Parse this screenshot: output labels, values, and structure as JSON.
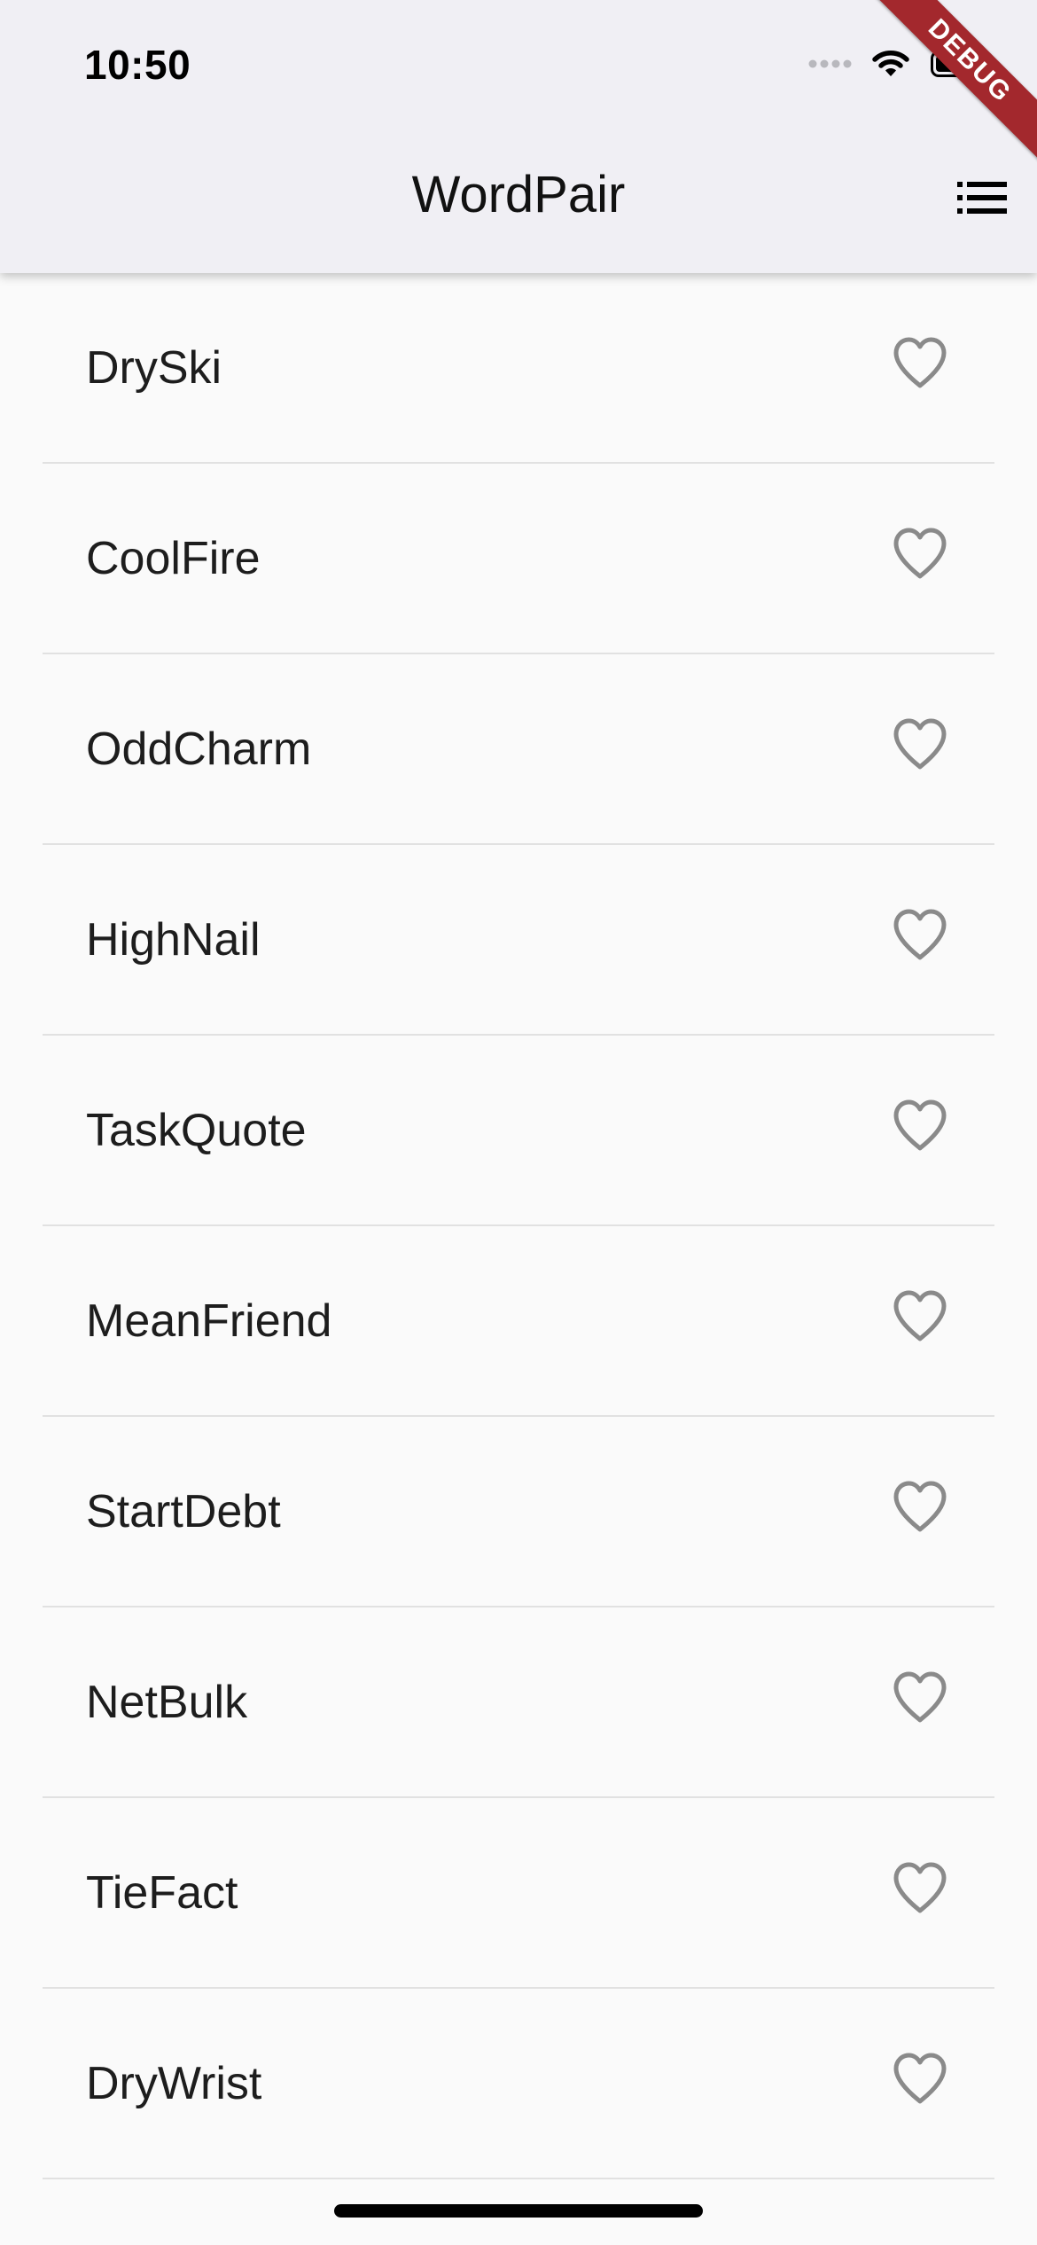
{
  "status_bar": {
    "time": "10:50",
    "signal_icon": "cellular-signal-icon",
    "wifi_icon": "wifi-icon",
    "battery_icon": "battery-icon"
  },
  "app_bar": {
    "title": "WordPair",
    "list_button_icon": "list-icon"
  },
  "debug_banner": {
    "label": "DEBUG",
    "color": "#a3282d"
  },
  "word_pairs": [
    {
      "label": "DrySki",
      "favorite": false
    },
    {
      "label": "CoolFire",
      "favorite": false
    },
    {
      "label": "OddCharm",
      "favorite": false
    },
    {
      "label": "HighNail",
      "favorite": false
    },
    {
      "label": "TaskQuote",
      "favorite": false
    },
    {
      "label": "MeanFriend",
      "favorite": false
    },
    {
      "label": "StartDebt",
      "favorite": false
    },
    {
      "label": "NetBulk",
      "favorite": false
    },
    {
      "label": "TieFact",
      "favorite": false
    },
    {
      "label": "DryWrist",
      "favorite": false
    }
  ],
  "favorite_icon": "heart-outline-icon",
  "colors": {
    "app_bar_bg": "#f0eff4",
    "list_bg": "#fafafa",
    "heart_outline": "#8a8a8a",
    "divider": "#e1e1e1"
  }
}
